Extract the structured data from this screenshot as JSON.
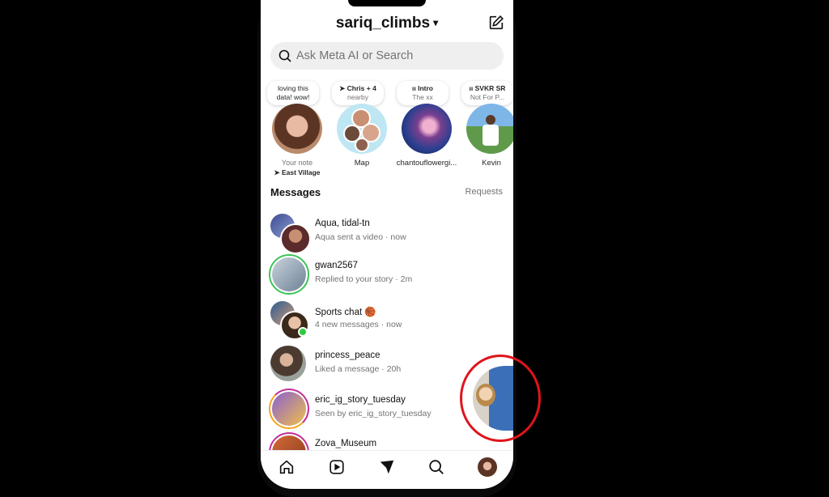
{
  "header": {
    "username": "sariq_climbs",
    "chevron": "▾"
  },
  "search": {
    "placeholder": "Ask Meta AI or Search"
  },
  "notes": [
    {
      "bubble_line1": "loving this",
      "bubble_line2": "data! wow!",
      "label": "Your note",
      "location": "East Village"
    },
    {
      "bubble_line1": "Chris + 4",
      "bubble_line2": "nearby",
      "label": "Map"
    },
    {
      "bubble_line1": "Intro",
      "bubble_line2": "The xx",
      "label": "chantouflowergi..."
    },
    {
      "bubble_line1": "SVKR SR",
      "bubble_line2": "Not For P...",
      "label": "Kevin"
    }
  ],
  "messages_section": {
    "title": "Messages",
    "requests_label": "Requests"
  },
  "messages": [
    {
      "name": "Aqua, tidal-tn",
      "meta": "Aqua sent a video · now"
    },
    {
      "name": "gwan2567",
      "meta": "Replied to your story · 2m"
    },
    {
      "name": "Sports chat 🏀",
      "meta": "4 new messages · now"
    },
    {
      "name": "princess_peace",
      "meta": "Liked a message · 20h"
    },
    {
      "name": "eric_ig_story_tuesday",
      "meta": "Seen by eric_ig_story_tuesday"
    },
    {
      "name": "Zova_Museum",
      "meta": ""
    }
  ],
  "tabs": [
    "home",
    "reels",
    "messages",
    "search",
    "profile"
  ],
  "colors": {
    "annotation_circle": "#e0141c",
    "online_dot": "#2ecc40",
    "story_ring_green": "#3cc457"
  }
}
